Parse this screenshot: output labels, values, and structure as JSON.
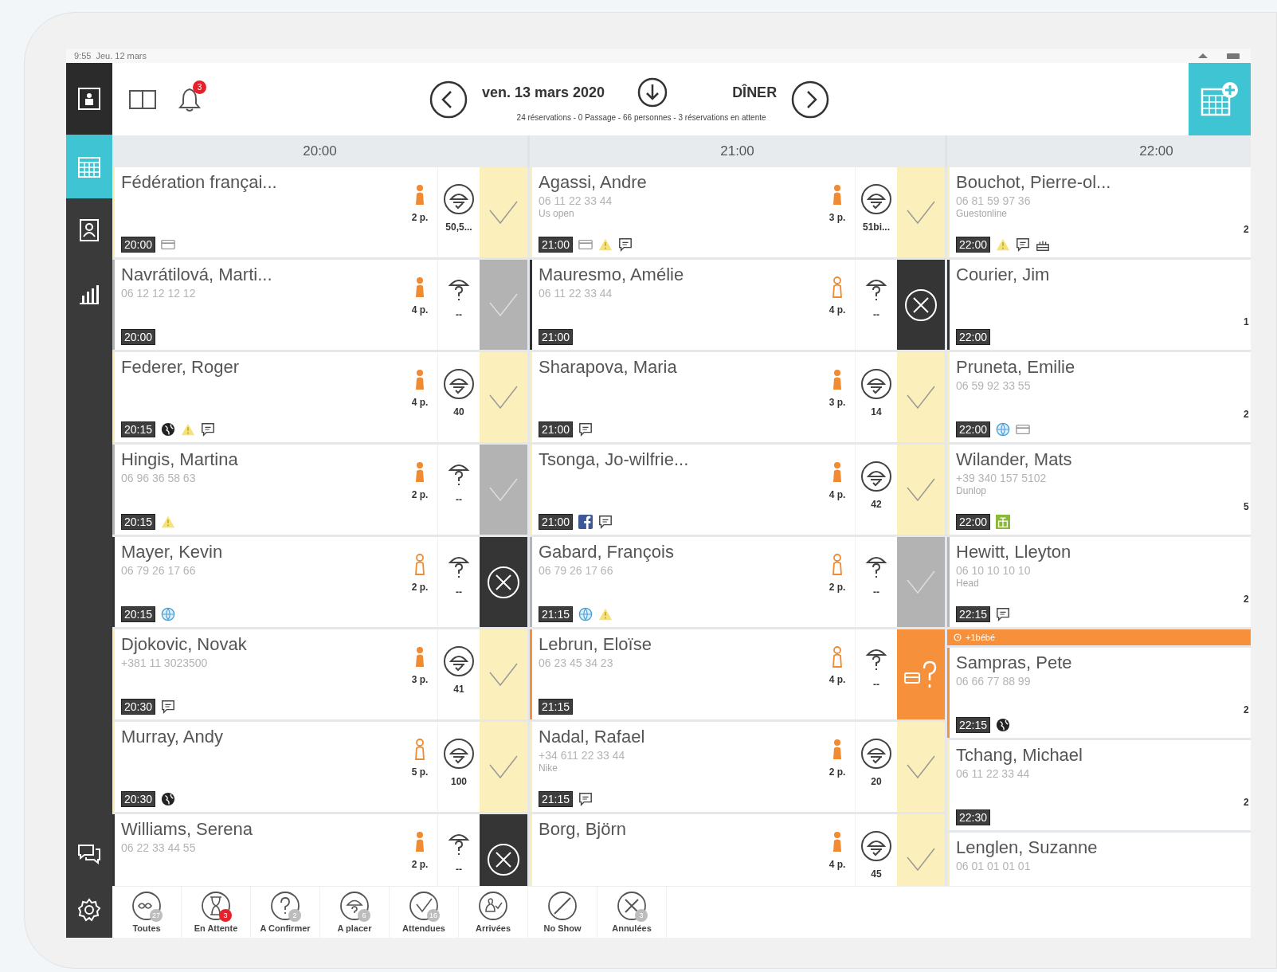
{
  "status_bar": {
    "time": "9:55",
    "date": "Jeu. 12 mars"
  },
  "sidebar": {
    "items": [
      {
        "kind": "frame",
        "selected": false
      },
      {
        "kind": "calendar",
        "selected": true
      },
      {
        "kind": "contacts",
        "selected": false
      },
      {
        "kind": "stats",
        "selected": false
      },
      {
        "kind": "chat",
        "selected": false
      },
      {
        "kind": "settings",
        "selected": false
      }
    ]
  },
  "toolbar": {
    "notifications": "3",
    "date": "ven. 13 mars 2020",
    "service": "DÎNER",
    "summary": "24 réservations - 0 Passage - 66 personnes - 3 réservations en attente"
  },
  "columns": [
    {
      "time": "20:00",
      "clipped": false,
      "bookings": [
        {
          "name": "Fédération françai...",
          "time": "20:00",
          "tags": [
            {
              "kind": "card"
            }
          ],
          "confirmed": true,
          "covers": "2 p.",
          "assigned": true,
          "table_label": "50,5...",
          "kind": "confirmed"
        },
        {
          "name": "Navrátilová, Marti...",
          "phone": "06 12 12 12 12",
          "time": "20:00",
          "confirmed": true,
          "covers": "4 p.",
          "assigned": false,
          "table_label": "--",
          "kind": "arrived"
        },
        {
          "name": "Federer, Roger",
          "time": "20:15",
          "tags": [
            {
              "kind": "globe"
            },
            {
              "kind": "warning"
            },
            {
              "kind": "message"
            }
          ],
          "confirmed": true,
          "covers": "4 p.",
          "assigned": true,
          "table_label": "40",
          "kind": "confirmed"
        },
        {
          "name": "Hingis, Martina",
          "phone": "06 96 36 58 63",
          "time": "20:15",
          "tags": [
            {
              "kind": "warning"
            }
          ],
          "confirmed": true,
          "covers": "2 p.",
          "assigned": false,
          "table_label": "--",
          "kind": "arrived"
        },
        {
          "name": "Mayer, Kevin",
          "phone": "06 79 26 17 66",
          "time": "20:15",
          "tags": [
            {
              "kind": "web"
            }
          ],
          "confirmed": false,
          "covers": "2 p.",
          "assigned": false,
          "table_label": "--",
          "kind": "cancelled"
        },
        {
          "name": "Djokovic, Novak",
          "phone": "+381 11 3023500",
          "time": "20:30",
          "tags": [
            {
              "kind": "message"
            }
          ],
          "confirmed": true,
          "covers": "3 p.",
          "assigned": true,
          "table_label": "41",
          "kind": "confirmed"
        },
        {
          "name": "Murray, Andy",
          "time": "20:30",
          "tags": [
            {
              "kind": "globe"
            }
          ],
          "confirmed": false,
          "covers": "5 p.",
          "assigned": true,
          "table_label": "100",
          "kind": "confirmed"
        },
        {
          "name": "Williams, Serena",
          "phone": "06 22 33 44 55",
          "confirmed": true,
          "covers": "2 p.",
          "assigned": false,
          "table_label": "--",
          "kind": "cancelled"
        }
      ]
    },
    {
      "time": "21:00",
      "clipped": false,
      "bookings": [
        {
          "name": "Agassi, Andre",
          "phone": "06 11 22 33 44",
          "note": "Us open",
          "time": "21:00",
          "tags": [
            {
              "kind": "card"
            },
            {
              "kind": "warning"
            },
            {
              "kind": "message"
            }
          ],
          "confirmed": true,
          "covers": "3 p.",
          "assigned": true,
          "table_label": "51bi...",
          "kind": "confirmed"
        },
        {
          "name": "Mauresmo, Amélie",
          "phone": "06 11 22 33 44",
          "time": "21:00",
          "confirmed": false,
          "covers": "4 p.",
          "assigned": false,
          "table_label": "--",
          "kind": "cancelled"
        },
        {
          "name": "Sharapova, Maria",
          "time": "21:00",
          "tags": [
            {
              "kind": "message"
            }
          ],
          "confirmed": true,
          "covers": "3 p.",
          "assigned": true,
          "table_label": "14",
          "kind": "confirmed"
        },
        {
          "name": "Tsonga, Jo-wilfrie...",
          "time": "21:00",
          "tags": [
            {
              "kind": "social"
            },
            {
              "kind": "message"
            }
          ],
          "confirmed": true,
          "covers": "4 p.",
          "assigned": true,
          "table_label": "42",
          "kind": "confirmed"
        },
        {
          "name": "Gabard, François",
          "phone": "06 79 26 17 66",
          "time": "21:15",
          "tags": [
            {
              "kind": "web"
            },
            {
              "kind": "warning"
            }
          ],
          "confirmed": false,
          "covers": "2 p.",
          "assigned": false,
          "table_label": "--",
          "kind": "arrived"
        },
        {
          "name": "Lebrun, Eloïse",
          "phone": "06 23 45 34 23",
          "time": "21:15",
          "confirmed": false,
          "covers": "4 p.",
          "assigned": false,
          "table_label": "--",
          "kind": "pending"
        },
        {
          "name": "Nadal, Rafael",
          "phone": "+34 611 22 33 44",
          "note": "Nike",
          "time": "21:15",
          "tags": [
            {
              "kind": "message"
            }
          ],
          "confirmed": true,
          "covers": "2 p.",
          "assigned": true,
          "table_label": "20",
          "kind": "confirmed"
        },
        {
          "name": "Borg, Björn",
          "confirmed": true,
          "covers": "4 p.",
          "assigned": true,
          "table_label": "45",
          "kind": "confirmed"
        }
      ]
    },
    {
      "time": "22:00",
      "clipped": true,
      "bookings": [
        {
          "name": "Bouchot, Pierre-ol...",
          "phone": "06 81 59 97 36",
          "note": "Guestonline",
          "time": "22:00",
          "tags": [
            {
              "kind": "warning"
            },
            {
              "kind": "message"
            },
            {
              "kind": "cake"
            }
          ],
          "covers": "2",
          "kind": "confirmed"
        },
        {
          "name": "Courier, Jim",
          "time": "22:00",
          "covers": "1",
          "kind": "cancelled"
        },
        {
          "name": "Pruneta, Emilie",
          "phone": "06 59 92 33 55",
          "time": "22:00",
          "tags": [
            {
              "kind": "web"
            },
            {
              "kind": "card"
            }
          ],
          "covers": "2",
          "kind": "confirmed"
        },
        {
          "name": "Wilander, Mats",
          "phone": "+39 340 157 5102",
          "note": "Dunlop",
          "time": "22:00",
          "tags": [
            {
              "kind": "gift"
            }
          ],
          "covers": "5",
          "kind": "confirmed"
        },
        {
          "name": "Hewitt, Lleyton",
          "phone": "06 10 10 10 10",
          "note": "Head",
          "time": "22:15",
          "tags": [
            {
              "kind": "message"
            }
          ],
          "covers": "2",
          "kind": "arrived"
        },
        {
          "name": "Sampras, Pete",
          "banner": "+1bébé",
          "phone": "06 66 77 88 99",
          "time": "22:15",
          "tags": [
            {
              "kind": "globe"
            }
          ],
          "covers": "2",
          "kind": "pending"
        },
        {
          "name": "Tchang, Michael",
          "phone": "06 11 22 33 44",
          "time": "22:30",
          "covers": "2",
          "kind": "confirmed"
        },
        {
          "name": "Lenglen, Suzanne",
          "phone": "06 01 01 01 01",
          "kind": "confirmed"
        }
      ]
    }
  ],
  "filters": [
    {
      "kind": "all",
      "label": "Toutes",
      "count": "27",
      "color": "#bdbdbd"
    },
    {
      "kind": "waiting",
      "label": "En Attente",
      "count": "3",
      "color": "#e8202a"
    },
    {
      "kind": "confirm",
      "label": "A Confirmer",
      "count": "2",
      "color": "#bdbdbd"
    },
    {
      "kind": "place",
      "label": "A placer",
      "count": "6",
      "color": "#bdbdbd"
    },
    {
      "kind": "expected",
      "label": "Attendues",
      "count": "16",
      "color": "#bdbdbd"
    },
    {
      "kind": "arrived",
      "label": "Arrivées"
    },
    {
      "kind": "noshow",
      "label": "No Show"
    },
    {
      "kind": "cancelled",
      "label": "Annulées",
      "count": "3",
      "color": "#bdbdbd"
    }
  ]
}
